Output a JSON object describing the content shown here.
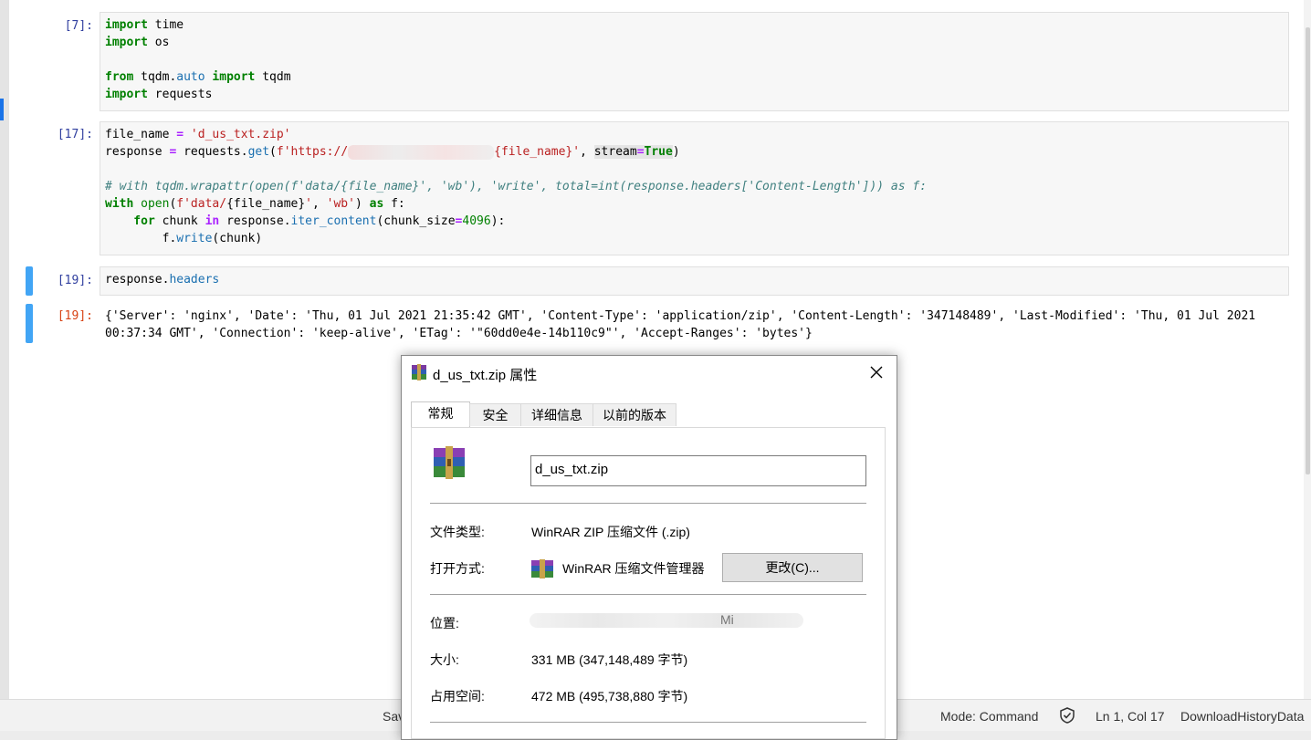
{
  "cells": {
    "c1": {
      "prompt": "[7]:"
    },
    "c2": {
      "prompt": "[17]:"
    },
    "c3": {
      "prompt": "[19]:"
    },
    "c4": {
      "prompt": "[19]:",
      "line1": "{'Server': 'nginx', 'Date': 'Thu, 01 Jul 2021 21:35:42 GMT', 'Content-Type': 'application/zip', 'Content-Length': '347148489', 'Last-Modified': 'Thu, 01 Jul 2021",
      "line2": "00:37:34 GMT', 'Connection': 'keep-alive', 'ETag': '\"60dd0e4e-14b110c9\"', 'Accept-Ranges': 'bytes'}"
    }
  },
  "code": {
    "c1": {
      "l1_kw": "import",
      "l1_rest": " time",
      "l2_kw": "import",
      "l2_rest": " os",
      "l4_kw1": "from",
      "l4_mod1": " tqdm.",
      "l4_mod2": "auto",
      "l4_kw2": " import",
      "l4_rest": " tqdm",
      "l5_kw": "import",
      "l5_rest": " requests"
    },
    "c2": {
      "l1_a": "file_name ",
      "l1_op": "=",
      "l1_str": " 'd_us_txt.zip'",
      "l2_a": "response ",
      "l2_op": "=",
      "l2_b": " requests.",
      "l2_fn": "get",
      "l2_c": "(",
      "l2_str1": "f'https://",
      "l2_str2": "{file_name}",
      "l2_str3": "'",
      "l2_d": ", ",
      "l2_hl_a": "stream",
      "l2_hl_op": "=",
      "l2_hl_kw": "True",
      "l2_e": ")",
      "l4_cm": "# with tqdm.wrapattr(open(f'data/{file_name}', 'wb'), 'write', total=int(response.headers['Content-Length'])) as f:",
      "l5_kw": "with",
      "l5_bi": " open",
      "l5_a": "(",
      "l5_str1": "f'data/",
      "l5_b": "{file_name}",
      "l5_str2": "'",
      "l5_c": ", ",
      "l5_str3": "'wb'",
      "l5_d": ")",
      "l5_kw2": " as",
      "l5_e": " f:",
      "l6_kw": "    for",
      "l6_a": " chunk ",
      "l6_kw2": "in",
      "l6_b": " response.",
      "l6_fn": "iter_content",
      "l6_c": "(chunk_size",
      "l6_op": "=",
      "l6_num": "4096",
      "l6_d": "):",
      "l7_a": "        f.",
      "l7_fn": "write",
      "l7_b": "(chunk)"
    },
    "c3": {
      "a": "response.",
      "b": "headers"
    }
  },
  "status": {
    "save": "Sav",
    "mode": "Mode: Command",
    "position": "Ln 1, Col 17",
    "file": "DownloadHistoryData"
  },
  "dialog": {
    "title": "d_us_txt.zip 属性",
    "tabs": [
      "常规",
      "安全",
      "详细信息",
      "以前的版本"
    ],
    "filename": "d_us_txt.zip",
    "rows": {
      "type_label": "文件类型:",
      "type_value": "WinRAR ZIP 压缩文件 (.zip)",
      "open_label": "打开方式:",
      "open_value": "WinRAR 压缩文件管理器",
      "change_button": "更改(C)...",
      "location_label": "位置:",
      "location_value": "Mi",
      "size_label": "大小:",
      "size_value": "331 MB (347,148,489 字节)",
      "disk_label": "占用空间:",
      "disk_value": "472 MB (495,738,880 字节)"
    }
  },
  "colors": {
    "accent": "#42a5f5",
    "in_prompt": "#303f9f",
    "out_prompt": "#d84315"
  }
}
